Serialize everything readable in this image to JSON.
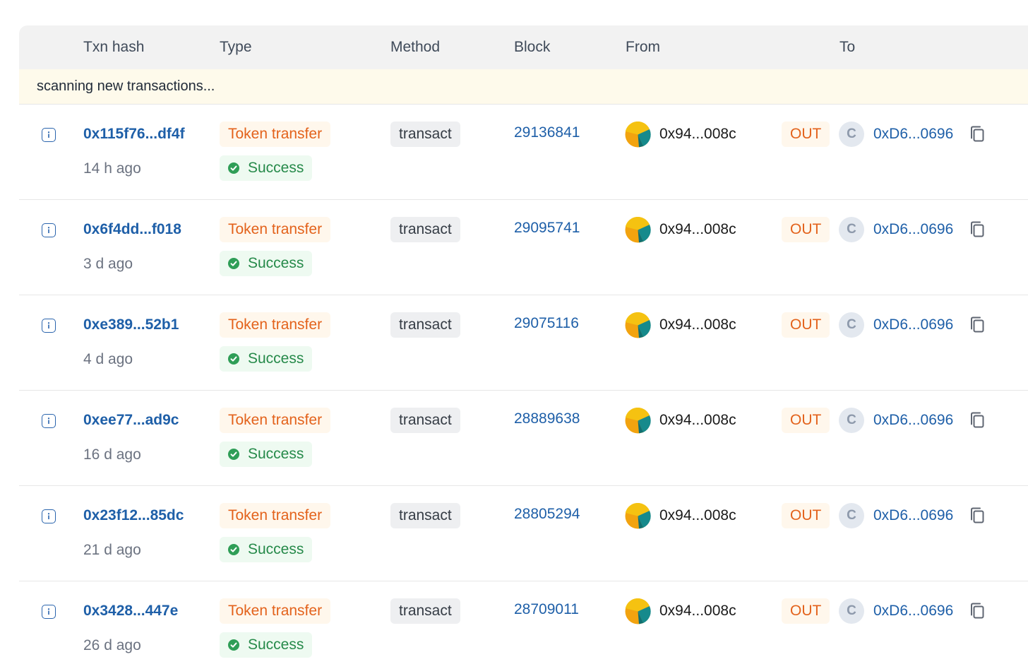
{
  "headers": {
    "txn_hash": "Txn hash",
    "type": "Type",
    "method": "Method",
    "block": "Block",
    "from": "From",
    "to": "To"
  },
  "banner": "scanning new transactions...",
  "colors": {
    "link": "#1e5fa8",
    "token_transfer": "#e3621b",
    "success": "#268a4a",
    "header_bg": "#f2f2f2",
    "banner_bg": "#fefaeb"
  },
  "rows": [
    {
      "hash": "0x115f76...df4f",
      "age": "14 h ago",
      "type": "Token transfer",
      "status": "Success",
      "method": "transact",
      "block": "29136841",
      "from": "0x94...008c",
      "direction": "OUT",
      "to_avatar": "C",
      "to": "0xD6...0696"
    },
    {
      "hash": "0x6f4dd...f018",
      "age": "3 d ago",
      "type": "Token transfer",
      "status": "Success",
      "method": "transact",
      "block": "29095741",
      "from": "0x94...008c",
      "direction": "OUT",
      "to_avatar": "C",
      "to": "0xD6...0696"
    },
    {
      "hash": "0xe389...52b1",
      "age": "4 d ago",
      "type": "Token transfer",
      "status": "Success",
      "method": "transact",
      "block": "29075116",
      "from": "0x94...008c",
      "direction": "OUT",
      "to_avatar": "C",
      "to": "0xD6...0696"
    },
    {
      "hash": "0xee77...ad9c",
      "age": "16 d ago",
      "type": "Token transfer",
      "status": "Success",
      "method": "transact",
      "block": "28889638",
      "from": "0x94...008c",
      "direction": "OUT",
      "to_avatar": "C",
      "to": "0xD6...0696"
    },
    {
      "hash": "0x23f12...85dc",
      "age": "21 d ago",
      "type": "Token transfer",
      "status": "Success",
      "method": "transact",
      "block": "28805294",
      "from": "0x94...008c",
      "direction": "OUT",
      "to_avatar": "C",
      "to": "0xD6...0696"
    },
    {
      "hash": "0x3428...447e",
      "age": "26 d ago",
      "type": "Token transfer",
      "status": "Success",
      "method": "transact",
      "block": "28709011",
      "from": "0x94...008c",
      "direction": "OUT",
      "to_avatar": "C",
      "to": "0xD6...0696"
    }
  ]
}
